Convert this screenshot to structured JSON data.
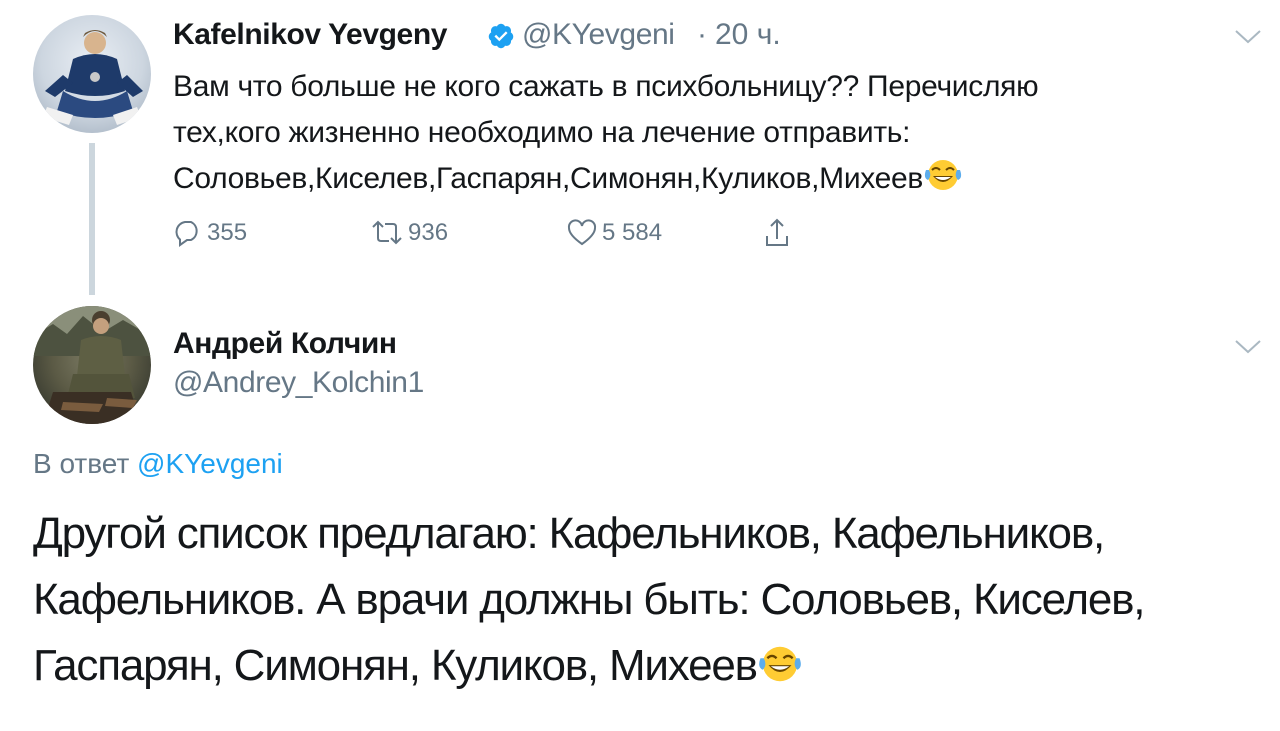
{
  "tweet1": {
    "author_name": "Kafelnikov Yevgeny",
    "handle": "@KYevgeni",
    "separator": "·",
    "time": "20 ч.",
    "verified": true,
    "text_lines": [
      "Вам что больше не кого сажать в психбольницу?? Перечисляю",
      "тех,кого жизненно необходимо на лечение отправить:",
      "Соловьев,Киселев,Гаспарян,Симонян,Куликов,Михеев"
    ],
    "emoji": "tears-of-joy-emoji",
    "actions": {
      "replies": "355",
      "retweets": "936",
      "likes": "5 584"
    }
  },
  "tweet2": {
    "author_name": "Андрей Колчин",
    "handle": "@Andrey_Kolchin1",
    "reply_prefix": "В ответ",
    "reply_mention": "@KYevgeni",
    "text_lines": [
      "Другой список предлагаю: Кафельников, Кафельников,",
      "Кафельников. А врачи должны быть: Соловьев, Киселев,",
      "Гаспарян, Симонян, Куликов, Михеев"
    ],
    "emoji": "tears-of-joy-emoji"
  },
  "colors": {
    "text": "#14171a",
    "secondary": "#657786",
    "accent": "#1da1f2",
    "thread_line": "#ccd6dd"
  },
  "icons": [
    "verified-badge-icon",
    "reply-icon",
    "retweet-icon",
    "like-icon",
    "share-icon",
    "chevron-down-icon"
  ]
}
